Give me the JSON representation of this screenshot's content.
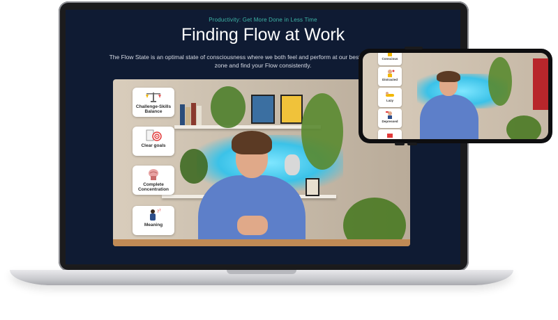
{
  "course": {
    "category": "Productivity: Get More Done in Less Time",
    "title": "Finding Flow at Work",
    "description": "The Flow State is an optimal state of consciousness where we both feel and perform at our best. hacks to get into the zone and find your Flow consistently."
  },
  "video": {
    "cards": [
      {
        "label": "Challenge-Skills Balance",
        "icon": "balance-icon"
      },
      {
        "label": "Clear goals",
        "icon": "target-icon"
      },
      {
        "label": "Complete Concentration",
        "icon": "brain-icon"
      },
      {
        "label": "Meaning",
        "icon": "thinking-person-icon"
      }
    ]
  },
  "phone": {
    "cards": [
      {
        "label": "Conscious",
        "icon": "person-icon"
      },
      {
        "label": "Distracted",
        "icon": "distracted-icon"
      },
      {
        "label": "Lazy",
        "icon": "lazy-icon"
      },
      {
        "label": "Depressed",
        "icon": "depressed-icon"
      }
    ]
  },
  "colors": {
    "screen_bg": "#0f1b33",
    "accent": "#3fb6a8",
    "sweater": "#5d7fc9",
    "glow": "#3bc2e8"
  }
}
